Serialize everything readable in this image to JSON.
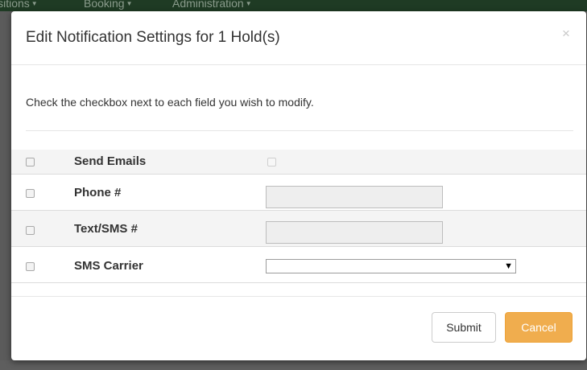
{
  "navbar": {
    "items": [
      {
        "label": "isitions"
      },
      {
        "label": "Booking"
      },
      {
        "label": "Administration"
      }
    ]
  },
  "modal": {
    "title": "Edit Notification Settings for 1 Hold(s)",
    "close_glyph": "×",
    "instructions": "Check the checkbox next to each field you wish to modify.",
    "fields": [
      {
        "label": "Send Emails"
      },
      {
        "label": "Phone #",
        "value": ""
      },
      {
        "label": "Text/SMS #",
        "value": ""
      },
      {
        "label": "SMS Carrier",
        "selected": ""
      }
    ],
    "select_arrow": "▼",
    "submit_label": "Submit",
    "cancel_label": "Cancel"
  },
  "colors": {
    "navbar": "#1f3b24",
    "cancel_button": "#f0ad4e",
    "backdrop": "#5d5d5d"
  }
}
